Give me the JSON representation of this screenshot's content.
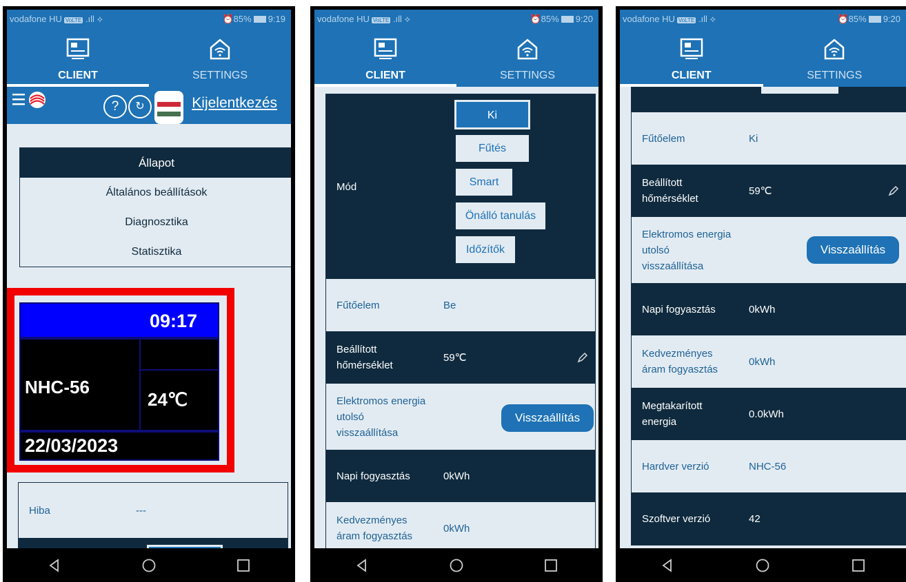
{
  "status": {
    "carrier": "vodafone HU",
    "chip": "VoLTE",
    "signal": ".ıll ⟡",
    "battery": "85%"
  },
  "tabs": {
    "client": "CLIENT",
    "settings": "SETTINGS"
  },
  "nav": {
    "logout": "Kijelentkezés",
    "help": "?",
    "refresh": "↻"
  },
  "menu": {
    "header": "Állapot",
    "items": [
      "Általános beállítások",
      "Diagnosztika",
      "Statisztika"
    ]
  },
  "display": {
    "time": "09:17",
    "name": "NHC-56",
    "temp": "24℃",
    "date": "22/03/2023"
  },
  "error": {
    "label": "Hiba",
    "value": "---"
  },
  "modes": {
    "label": "Mód",
    "buttons": [
      "Ki",
      "Fűtés",
      "Smart",
      "Önálló tanulás",
      "Időzítők"
    ]
  },
  "rows": {
    "heater": "Fűtőelem",
    "heater_on": "Be",
    "heater_off": "Ki",
    "settemp": "Beállított hőmérséklet",
    "settemp_val": "59℃",
    "reset_label": "Elektromos energia utolsó visszaállítása",
    "reset_btn": "Visszaállítás",
    "daily": "Napi fogyasztás",
    "daily_val": "0kWh",
    "discount": "Kedvezményes áram fogyasztás",
    "discount_val": "0kWh",
    "saved": "Megtakarított energia",
    "saved_val": "0.0kWh",
    "hw": "Hardver verzió",
    "hw_val": "NHC-56",
    "sw": "Szoftver verzió",
    "sw_val": "42"
  },
  "phones": [
    {
      "time": "9:19"
    },
    {
      "time": "9:20"
    },
    {
      "time": "9:20"
    }
  ]
}
